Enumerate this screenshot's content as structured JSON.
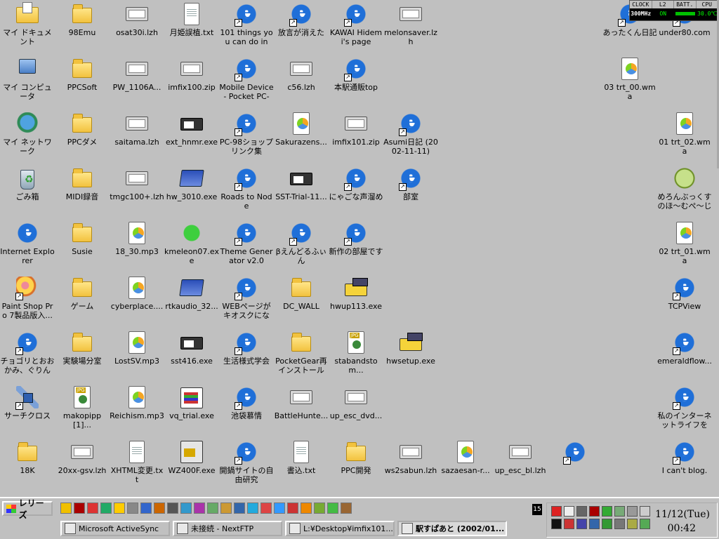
{
  "desktop": {
    "icons": [
      {
        "label": "マイ ドキュメント",
        "icon": "my-documents-icon",
        "type": "mydocs",
        "col": 0,
        "row": 0
      },
      {
        "label": "マイ コンピュータ",
        "icon": "my-computer-icon",
        "type": "computer",
        "col": 0,
        "row": 1
      },
      {
        "label": "マイ ネットワーク",
        "icon": "my-network-icon",
        "type": "network",
        "col": 0,
        "row": 2
      },
      {
        "label": "ごみ箱",
        "icon": "recycle-bin-icon",
        "type": "trash",
        "col": 0,
        "row": 3
      },
      {
        "label": "Internet Explorer",
        "icon": "internet-explorer-icon",
        "type": "ie",
        "col": 0,
        "row": 4
      },
      {
        "label": "Paint Shop Pro 7製品版入...",
        "icon": "paint-shop-pro-icon",
        "type": "paint",
        "col": 0,
        "row": 5,
        "shortcut": true
      },
      {
        "label": "チョゴリとおおかみ、ぐりんち...",
        "icon": "ie-shortcut-icon",
        "type": "ie",
        "col": 0,
        "row": 6,
        "shortcut": true
      },
      {
        "label": "サーチクロス",
        "icon": "satellite-icon",
        "type": "satellite",
        "col": 0,
        "row": 7,
        "shortcut": true
      },
      {
        "label": "18K",
        "icon": "folder-icon",
        "type": "folder",
        "col": 0,
        "row": 8
      },
      {
        "label": "98Emu",
        "icon": "folder-icon",
        "type": "folder",
        "col": 1,
        "row": 0
      },
      {
        "label": "PPCSoft",
        "icon": "folder-icon",
        "type": "folder",
        "col": 1,
        "row": 1
      },
      {
        "label": "PPCダメ",
        "icon": "folder-icon",
        "type": "folder",
        "col": 1,
        "row": 2
      },
      {
        "label": "MIDI録音",
        "icon": "folder-icon",
        "type": "folder",
        "col": 1,
        "row": 3
      },
      {
        "label": "Susie",
        "icon": "folder-icon",
        "type": "folder",
        "col": 1,
        "row": 4
      },
      {
        "label": "ゲーム",
        "icon": "folder-icon",
        "type": "folder",
        "col": 1,
        "row": 5
      },
      {
        "label": "実験場分室",
        "icon": "folder-icon",
        "type": "folder",
        "col": 1,
        "row": 6
      },
      {
        "label": "makopipp[1]...",
        "icon": "jpg-file-icon",
        "type": "jpg",
        "col": 1,
        "row": 7
      },
      {
        "label": "20xx-gsv.lzh",
        "icon": "archive-icon",
        "type": "window",
        "col": 1,
        "row": 8
      },
      {
        "label": "osat30i.lzh",
        "icon": "archive-icon",
        "type": "window",
        "col": 2,
        "row": 0
      },
      {
        "label": "PW_1106A...",
        "icon": "archive-icon",
        "type": "window",
        "col": 2,
        "row": 1
      },
      {
        "label": "saitama.lzh",
        "icon": "archive-icon",
        "type": "window",
        "col": 2,
        "row": 2
      },
      {
        "label": "tmgc100+.lzh",
        "icon": "archive-icon",
        "type": "window",
        "col": 2,
        "row": 3
      },
      {
        "label": "18_30.mp3",
        "icon": "media-file-icon",
        "type": "media",
        "col": 2,
        "row": 4
      },
      {
        "label": "cyberplace....",
        "icon": "media-file-icon",
        "type": "media",
        "col": 2,
        "row": 5
      },
      {
        "label": "LostSV.mp3",
        "icon": "media-file-icon",
        "type": "media",
        "col": 2,
        "row": 6
      },
      {
        "label": "Reichism.mp3",
        "icon": "media-file-icon",
        "type": "media",
        "col": 2,
        "row": 7
      },
      {
        "label": "XHTML変更.txt",
        "icon": "text-file-icon",
        "type": "file",
        "col": 2,
        "row": 8
      },
      {
        "label": "月姫誤植.txt",
        "icon": "text-file-icon",
        "type": "file",
        "col": 3,
        "row": 0
      },
      {
        "label": "imfix100.zip",
        "icon": "archive-icon",
        "type": "window",
        "col": 3,
        "row": 1
      },
      {
        "label": "ext_hnmr.exe",
        "icon": "exe-icon",
        "type": "exe",
        "col": 3,
        "row": 2
      },
      {
        "label": "hw_3010.exe",
        "icon": "app-icon",
        "type": "app",
        "col": 3,
        "row": 3
      },
      {
        "label": "kmeleon07.exe",
        "icon": "kmeleon-icon",
        "type": "green",
        "col": 3,
        "row": 4
      },
      {
        "label": "rtkaudio_32...",
        "icon": "app-icon",
        "type": "app",
        "col": 3,
        "row": 5
      },
      {
        "label": "sst416.exe",
        "icon": "exe-icon",
        "type": "exe",
        "col": 3,
        "row": 6
      },
      {
        "label": "vq_trial.exe",
        "icon": "installer-icon",
        "type": "hw",
        "col": 3,
        "row": 7
      },
      {
        "label": "WZ400F.exe",
        "icon": "installer-icon",
        "type": "wz",
        "col": 3,
        "row": 8
      },
      {
        "label": "101 things you can do in M...",
        "icon": "ie-shortcut-icon",
        "type": "ie",
        "col": 4,
        "row": 0,
        "shortcut": true
      },
      {
        "label": "Mobile Device - Pocket PC-",
        "icon": "ie-shortcut-icon",
        "type": "ie",
        "col": 4,
        "row": 1,
        "shortcut": true
      },
      {
        "label": "PC-98ショップリンク集",
        "icon": "ie-shortcut-icon",
        "type": "ie",
        "col": 4,
        "row": 2,
        "shortcut": true
      },
      {
        "label": "Roads to Node",
        "icon": "ie-shortcut-icon",
        "type": "ie",
        "col": 4,
        "row": 3,
        "shortcut": true
      },
      {
        "label": "Theme Generator v2.0",
        "icon": "ie-shortcut-icon",
        "type": "ie",
        "col": 4,
        "row": 4,
        "shortcut": true
      },
      {
        "label": "WEBページがキオスクになる...",
        "icon": "ie-shortcut-icon",
        "type": "ie",
        "col": 4,
        "row": 5,
        "shortcut": true
      },
      {
        "label": "生活様式学会",
        "icon": "ie-shortcut-icon",
        "type": "ie",
        "col": 4,
        "row": 6,
        "shortcut": true
      },
      {
        "label": "池袋慕情",
        "icon": "ie-shortcut-icon",
        "type": "ie",
        "col": 4,
        "row": 7,
        "shortcut": true
      },
      {
        "label": "開鍋サイトの自由研究",
        "icon": "ie-shortcut-icon",
        "type": "ie",
        "col": 4,
        "row": 8,
        "shortcut": true
      },
      {
        "label": "放言が消えた",
        "icon": "ie-shortcut-icon",
        "type": "ie",
        "col": 5,
        "row": 0,
        "shortcut": true
      },
      {
        "label": "c56.lzh",
        "icon": "archive-icon",
        "type": "window",
        "col": 5,
        "row": 1
      },
      {
        "label": "Sakurazens...",
        "icon": "media-file-icon",
        "type": "media",
        "col": 5,
        "row": 2
      },
      {
        "label": "SST-Trial-11...",
        "icon": "exe-icon",
        "type": "exe",
        "col": 5,
        "row": 3
      },
      {
        "label": "βえんどるふぃん",
        "icon": "ie-shortcut-icon",
        "type": "ie",
        "col": 5,
        "row": 4,
        "shortcut": true
      },
      {
        "label": "DC_WALL",
        "icon": "folder-icon",
        "type": "folder",
        "col": 5,
        "row": 5
      },
      {
        "label": "PocketGear再インストール",
        "icon": "folder-icon",
        "type": "folder",
        "col": 5,
        "row": 6
      },
      {
        "label": "BattleHunte...",
        "icon": "archive-icon",
        "type": "window",
        "col": 5,
        "row": 7
      },
      {
        "label": "書込.txt",
        "icon": "text-file-icon",
        "type": "file",
        "col": 5,
        "row": 8
      },
      {
        "label": "KAWAI Hidemi's page",
        "icon": "ie-shortcut-icon",
        "type": "ie",
        "col": 6,
        "row": 0,
        "shortcut": true
      },
      {
        "label": "本駅通販top",
        "icon": "ie-shortcut-icon",
        "type": "ie",
        "col": 6,
        "row": 1,
        "shortcut": true
      },
      {
        "label": "imfix101.zip",
        "icon": "archive-icon",
        "type": "window",
        "col": 6,
        "row": 2
      },
      {
        "label": "にゃごな声溜め",
        "icon": "ie-shortcut-icon",
        "type": "ie",
        "col": 6,
        "row": 3,
        "shortcut": true
      },
      {
        "label": "新作の部屋です",
        "icon": "ie-shortcut-icon",
        "type": "ie",
        "col": 6,
        "row": 4,
        "shortcut": true
      },
      {
        "label": "hwup113.exe",
        "icon": "installer-icon",
        "type": "hwup",
        "col": 6,
        "row": 5
      },
      {
        "label": "stabandstom...",
        "icon": "jpg-file-icon",
        "type": "jpg",
        "col": 6,
        "row": 6
      },
      {
        "label": "up_esc_dvd...",
        "icon": "archive-icon",
        "type": "window",
        "col": 6,
        "row": 7
      },
      {
        "label": "PPC開発",
        "icon": "folder-icon",
        "type": "folder",
        "col": 6,
        "row": 8
      },
      {
        "label": "melonsaver.lzh",
        "icon": "archive-icon",
        "type": "window",
        "col": 7,
        "row": 0
      },
      {
        "label": "Asumi日記 (2002-11-11)",
        "icon": "ie-shortcut-icon",
        "type": "ie",
        "col": 7,
        "row": 2,
        "shortcut": true
      },
      {
        "label": "部室",
        "icon": "ie-shortcut-icon",
        "type": "ie",
        "col": 7,
        "row": 3,
        "shortcut": true
      },
      {
        "label": "hwsetup.exe",
        "icon": "installer-icon",
        "type": "hwup",
        "col": 7,
        "row": 6
      },
      {
        "label": "ws2sabun.lzh",
        "icon": "archive-icon",
        "type": "window",
        "col": 7,
        "row": 8
      },
      {
        "label": "sazaesan-r...",
        "icon": "media-file-icon",
        "type": "media",
        "col": 8,
        "row": 8
      },
      {
        "label": "up_esc_bl.lzh",
        "icon": "archive-icon",
        "type": "window",
        "col": 9,
        "row": 8
      },
      {
        "label": "",
        "icon": "ie-shortcut-icon",
        "type": "ie",
        "col": 10,
        "row": 8,
        "shortcut": true
      },
      {
        "label": "あったくん日記",
        "icon": "ie-shortcut-icon",
        "type": "ie",
        "col": 11,
        "row": 0,
        "shortcut": true
      },
      {
        "label": "03 trt_00.wma",
        "icon": "media-file-icon",
        "type": "media",
        "col": 11,
        "row": 1
      },
      {
        "label": "under80.com",
        "icon": "ie-shortcut-icon",
        "type": "ie",
        "col": 12,
        "row": 0,
        "shortcut": true
      },
      {
        "label": "01 trt_02.wma",
        "icon": "media-file-icon",
        "type": "media",
        "col": 12,
        "row": 2
      },
      {
        "label": "めろんぶっくすのほ～むぺ～じ",
        "icon": "melon-icon",
        "type": "melon",
        "col": 12,
        "row": 3
      },
      {
        "label": "02 trt_01.wma",
        "icon": "media-file-icon",
        "type": "media",
        "col": 12,
        "row": 4
      },
      {
        "label": "TCPView",
        "icon": "ie-shortcut-icon",
        "type": "ie",
        "col": 12,
        "row": 5,
        "shortcut": true
      },
      {
        "label": "emeraldflow...",
        "icon": "ie-shortcut-icon",
        "type": "ie",
        "col": 12,
        "row": 6,
        "shortcut": true
      },
      {
        "label": "私のインターネットライフをこ...",
        "icon": "ie-shortcut-icon",
        "type": "ie",
        "col": 12,
        "row": 7,
        "shortcut": true
      },
      {
        "label": "I can't blog.",
        "icon": "ie-shortcut-icon",
        "type": "ie",
        "col": 12,
        "row": 8,
        "shortcut": true
      }
    ]
  },
  "sysmon": {
    "headers": [
      "CLOCK",
      "L2",
      "BATT.",
      "CPU"
    ],
    "clock": "300MHz",
    "l2": "ON",
    "cpu": "30.0℃"
  },
  "taskbar": {
    "start_label": "レリーズ",
    "tasks": [
      {
        "label": "Microsoft ActiveSync",
        "active": false
      },
      {
        "label": "未接続 - NextFTP",
        "active": false
      },
      {
        "label": "L:¥Desktop¥imfix101...",
        "active": false
      },
      {
        "label": "駅すぱあと (2002/01...",
        "active": true
      }
    ],
    "badge": "15",
    "clock_date": "11/12(Tue)",
    "clock_time": "00:42",
    "quicklaunch_count": 22,
    "tray_count": 16
  }
}
